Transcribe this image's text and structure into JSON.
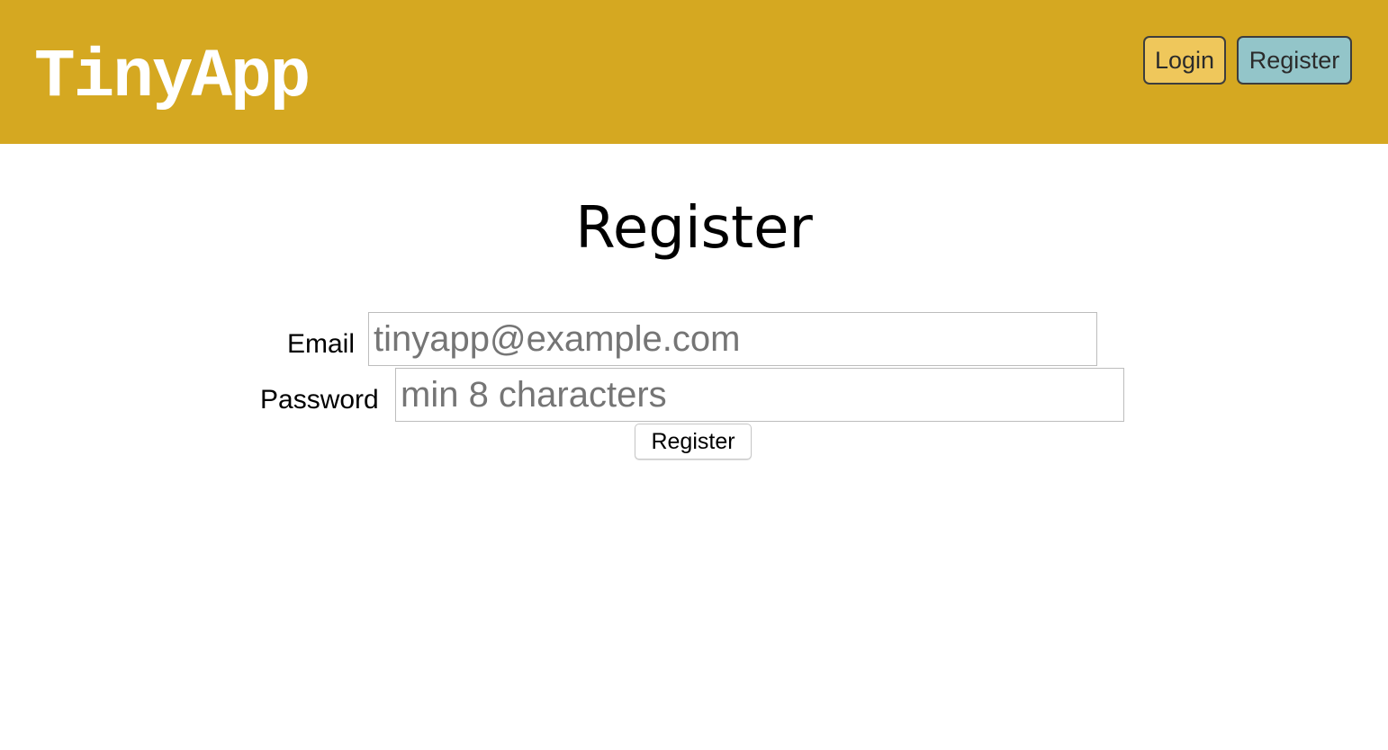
{
  "header": {
    "brand": "TinyApp",
    "background_color": "#d5a821",
    "nav": {
      "login_label": "Login",
      "login_color": "#efc75b",
      "register_label": "Register",
      "register_color": "#93c5c9"
    }
  },
  "main": {
    "title": "Register",
    "form": {
      "email_label": "Email",
      "email_placeholder": "tinyapp@example.com",
      "email_value": "",
      "password_label": "Password",
      "password_placeholder": "min 8 characters",
      "password_value": "",
      "submit_label": "Register"
    }
  }
}
